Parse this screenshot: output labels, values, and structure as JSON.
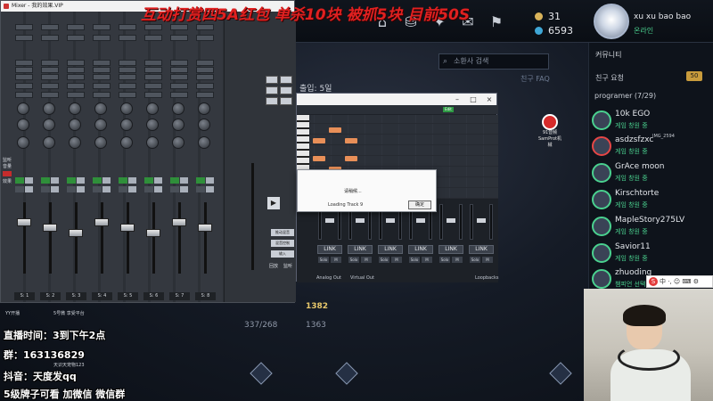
{
  "overlay": {
    "banner": "互动打赏四5A红包 单杀10块 被抓5块 目前50S",
    "stream_time": "直播时间：3到下午2点",
    "group": "群：163136829",
    "tiktok": "抖音：天度发qq",
    "bottom_ad": "5级牌子可看 加微信 微信群",
    "small_notes": [
      "YY开播",
      "5号微 享受平台",
      "天识天宠物123"
    ]
  },
  "game": {
    "currency": {
      "rp": "31",
      "be": "6593"
    },
    "profile": {
      "name": "xu xu bao bao",
      "status": "온라인"
    },
    "search_placeholder": "소환사 검색",
    "faq": "친구 FAQ",
    "round_label": "출입: 5일",
    "floors": [
      "337/268",
      "1382",
      "1363"
    ],
    "friends": {
      "header": "커뮤니티",
      "request": "친구 요청",
      "request_count": "50",
      "group": "programer (7/29)",
      "list": [
        {
          "name": "10k EGO",
          "status": "게임 창원 중"
        },
        {
          "name": "asdzsfzxc",
          "status": "게임 창원 중"
        },
        {
          "name": "GrAce moon",
          "status": "게임 창원 중"
        },
        {
          "name": "Kirschtorte",
          "status": "게임 창원 중"
        },
        {
          "name": "MapleStory275LV",
          "status": "게임 창원 중"
        },
        {
          "name": "Savior11",
          "status": "게임 창원 중"
        },
        {
          "name": "zhuoding",
          "status": "챔피언 선택"
        }
      ]
    },
    "desktop_shortcut": "91音频 SamProt机械",
    "image_label": "IMG_2594"
  },
  "mixer": {
    "title": "Mixer - 我的效果.VIP",
    "strip_labels": [
      "S: 1",
      "S: 2",
      "S: 3",
      "S: 4",
      "S: 5",
      "S: 6",
      "S: 7",
      "S: 8"
    ],
    "side_labels": [
      "监听",
      "音量",
      "效果"
    ],
    "right_buttons": [
      "推动混音",
      "混音控制",
      "输入"
    ],
    "right_labels": [
      "回放",
      "监听"
    ],
    "play_icon": "play-icon"
  },
  "daw": {
    "toolbar_label": "Edit",
    "strips": [
      "LINK",
      "LINK",
      "LINK",
      "LINK",
      "LINK",
      "LINK"
    ],
    "small_buttons": [
      "Solo",
      "M"
    ],
    "groups": [
      "Analog Out",
      "Virtual Out",
      "Loopbacks"
    ]
  },
  "dialog": {
    "title": "请稍候...",
    "subtitle": "Loading Track 9",
    "ok": "确定"
  },
  "ime": {
    "text": "中 ·, ☺ ⌨ ⚙"
  }
}
